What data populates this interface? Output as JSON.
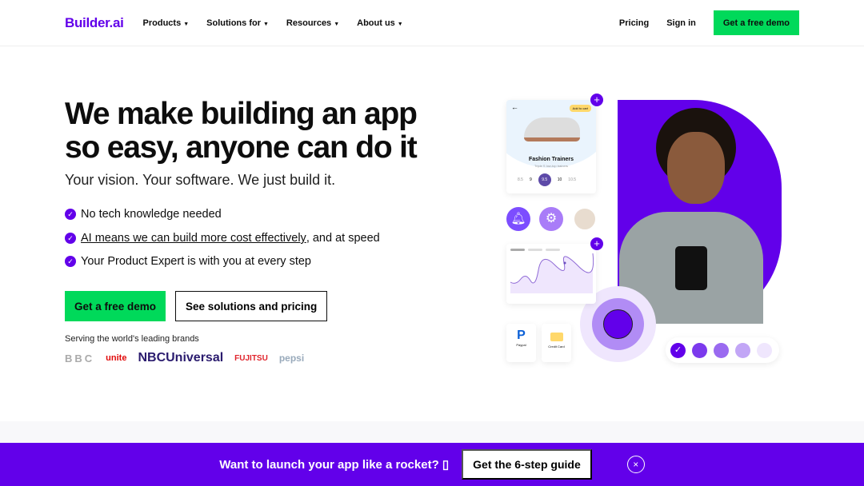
{
  "nav": {
    "logo": "Builder.ai",
    "items": [
      "Products",
      "Solutions for",
      "Resources",
      "About us"
    ],
    "pricing": "Pricing",
    "signin": "Sign in",
    "demo": "Get a free demo"
  },
  "hero": {
    "title": "We make building an app so easy, anyone can do it",
    "subtitle": "Your vision. Your software. We just build it.",
    "bullets": [
      {
        "text": "No tech knowledge needed"
      },
      {
        "link": "AI means we can build more cost effectively",
        "text": ", and at speed"
      },
      {
        "text": "Your Product Expert is with you at every step"
      }
    ],
    "cta_primary": "Get a free demo",
    "cta_secondary": "See solutions and pricing",
    "serving": "Serving the world's leading brands",
    "brands": [
      "BBC",
      "unite",
      "NBCUniversal",
      "FUJITSU",
      "pepsi"
    ]
  },
  "mockup": {
    "product_title": "Fashion Trainers",
    "product_sub": "Triple S low-top trainers",
    "add_to_cart": "Add to cart",
    "sizes": [
      "8.5",
      "9",
      "9.5",
      "10",
      "10.5"
    ],
    "selected_size": "9.5",
    "pay1": "Paypal",
    "pay2": "Credit Card"
  },
  "banner": {
    "text": "Want to launch your app like a rocket? ▯",
    "button": "Get the 6-step guide",
    "close": "×"
  },
  "colors": {
    "brand": "#6200ea",
    "accent": "#00d95a"
  }
}
